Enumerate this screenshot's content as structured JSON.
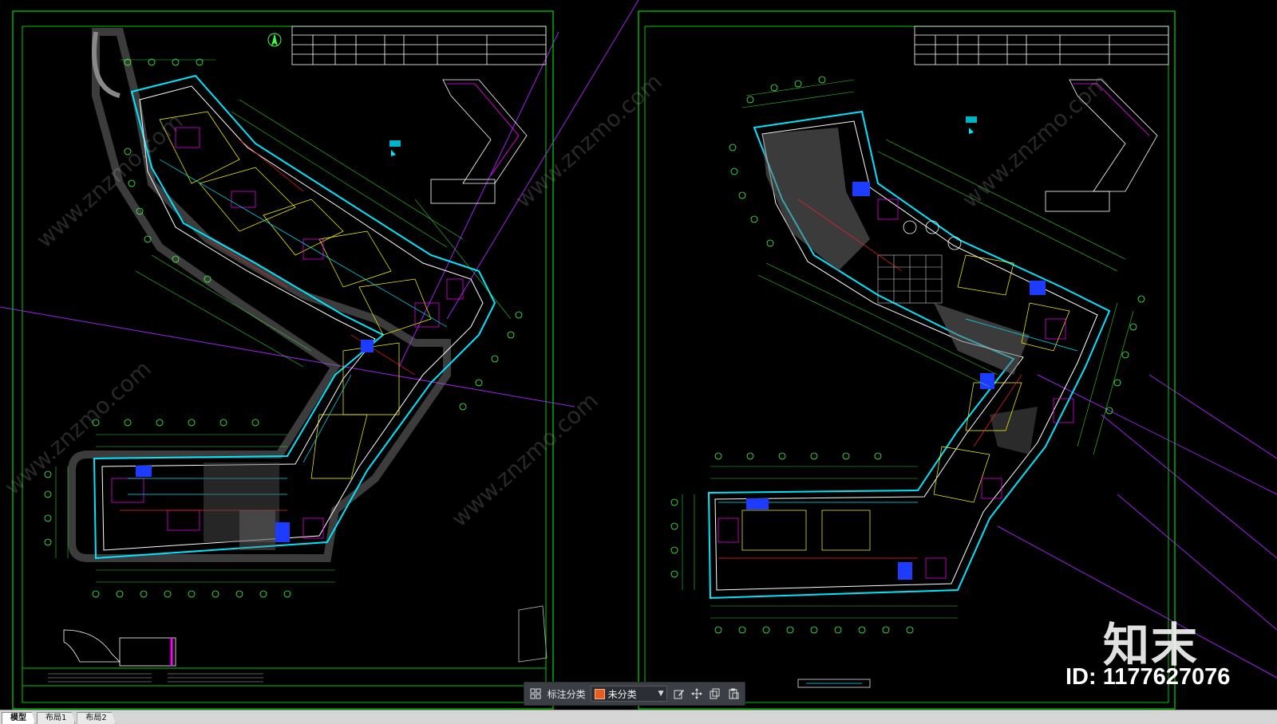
{
  "tabs": [
    {
      "label": "模型",
      "active": true
    },
    {
      "label": "布局1",
      "active": false
    },
    {
      "label": "布局2",
      "active": false
    }
  ],
  "toolbar": {
    "label": "标注分类",
    "select_value": "未分类",
    "select_color": "#e85d1f",
    "icons": [
      "grid-icon",
      "edit-icon",
      "move-icon",
      "copy-icon",
      "paste-icon"
    ]
  },
  "watermark": {
    "logo": "知末",
    "id_text": "ID: 1177627076",
    "diag_text": "www.znzmo.com"
  },
  "colors": {
    "background": "#000000",
    "frame": "#00c800",
    "wall_cyan": "#00e5ff",
    "wall_white": "#ffffff",
    "grid_green": "#40ff40",
    "magenta": "#ff00ff",
    "yellow": "#ffff00",
    "red": "#ff2020",
    "blue": "#1e3cff",
    "purple_line": "#a020f0"
  }
}
